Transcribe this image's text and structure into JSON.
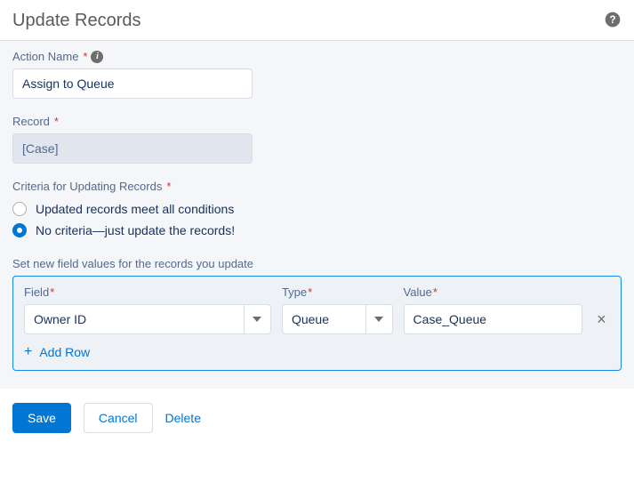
{
  "header": {
    "title": "Update Records"
  },
  "actionName": {
    "label": "Action Name",
    "value": "Assign to Queue"
  },
  "record": {
    "label": "Record",
    "value": "[Case]"
  },
  "criteria": {
    "label": "Criteria for Updating Records",
    "options": [
      {
        "label": "Updated records meet all conditions",
        "selected": false
      },
      {
        "label": "No criteria—just update the records!",
        "selected": true
      }
    ]
  },
  "fieldValues": {
    "sectionLabel": "Set new field values for the records you update",
    "headers": {
      "field": "Field",
      "type": "Type",
      "value": "Value"
    },
    "rows": [
      {
        "field": "Owner ID",
        "type": "Queue",
        "value": "Case_Queue"
      }
    ],
    "addRowLabel": "Add Row"
  },
  "footer": {
    "save": "Save",
    "cancel": "Cancel",
    "delete": "Delete"
  }
}
